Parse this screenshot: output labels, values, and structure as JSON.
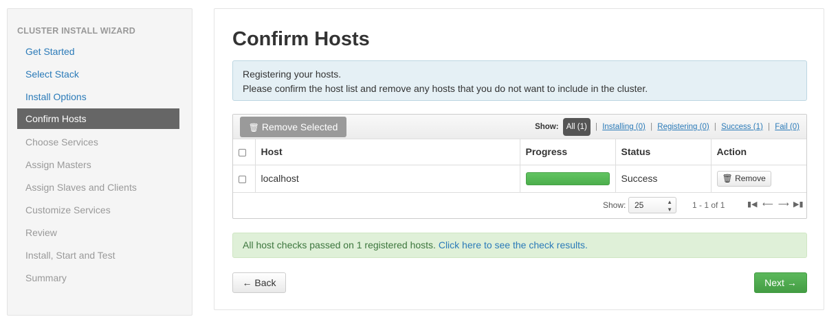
{
  "sidebar": {
    "header": "CLUSTER INSTALL WIZARD",
    "items": [
      {
        "label": "Get Started"
      },
      {
        "label": "Select Stack"
      },
      {
        "label": "Install Options"
      },
      {
        "label": "Confirm Hosts"
      },
      {
        "label": "Choose Services"
      },
      {
        "label": "Assign Masters"
      },
      {
        "label": "Assign Slaves and Clients"
      },
      {
        "label": "Customize Services"
      },
      {
        "label": "Review"
      },
      {
        "label": "Install, Start and Test"
      },
      {
        "label": "Summary"
      }
    ],
    "active_item": "Confirm Hosts"
  },
  "main": {
    "title": "Confirm Hosts",
    "info_line1": "Registering your hosts.",
    "info_line2": "Please confirm the host list and remove any hosts that you do not want to include in the cluster."
  },
  "toolbar": {
    "remove_selected_label": "Remove Selected",
    "show_label": "Show:",
    "filters": {
      "all": "All (1)",
      "installing": "Installing (0)",
      "registering": "Registering (0)",
      "success": "Success (1)",
      "fail": "Fail (0)"
    },
    "separator": "|"
  },
  "table": {
    "headers": {
      "host": "Host",
      "progress": "Progress",
      "status": "Status",
      "action": "Action"
    },
    "rows": [
      {
        "host": "localhost",
        "progress_percent": 100,
        "status": "Success",
        "action_label": "Remove"
      }
    ]
  },
  "pager": {
    "show_label": "Show:",
    "page_size": "25",
    "range_info": "1 - 1 of 1"
  },
  "success_alert": {
    "text": "All host checks passed on 1 registered hosts. ",
    "link_text": "Click here to see the check results."
  },
  "buttons": {
    "back": "← Back",
    "next": "Next →"
  },
  "colors": {
    "link": "#2a7ab8",
    "active_sidebar_bg": "#666666",
    "success_green": "#5cb85c",
    "info_bg": "#e5f0f5",
    "success_bg": "#dff0d8"
  }
}
